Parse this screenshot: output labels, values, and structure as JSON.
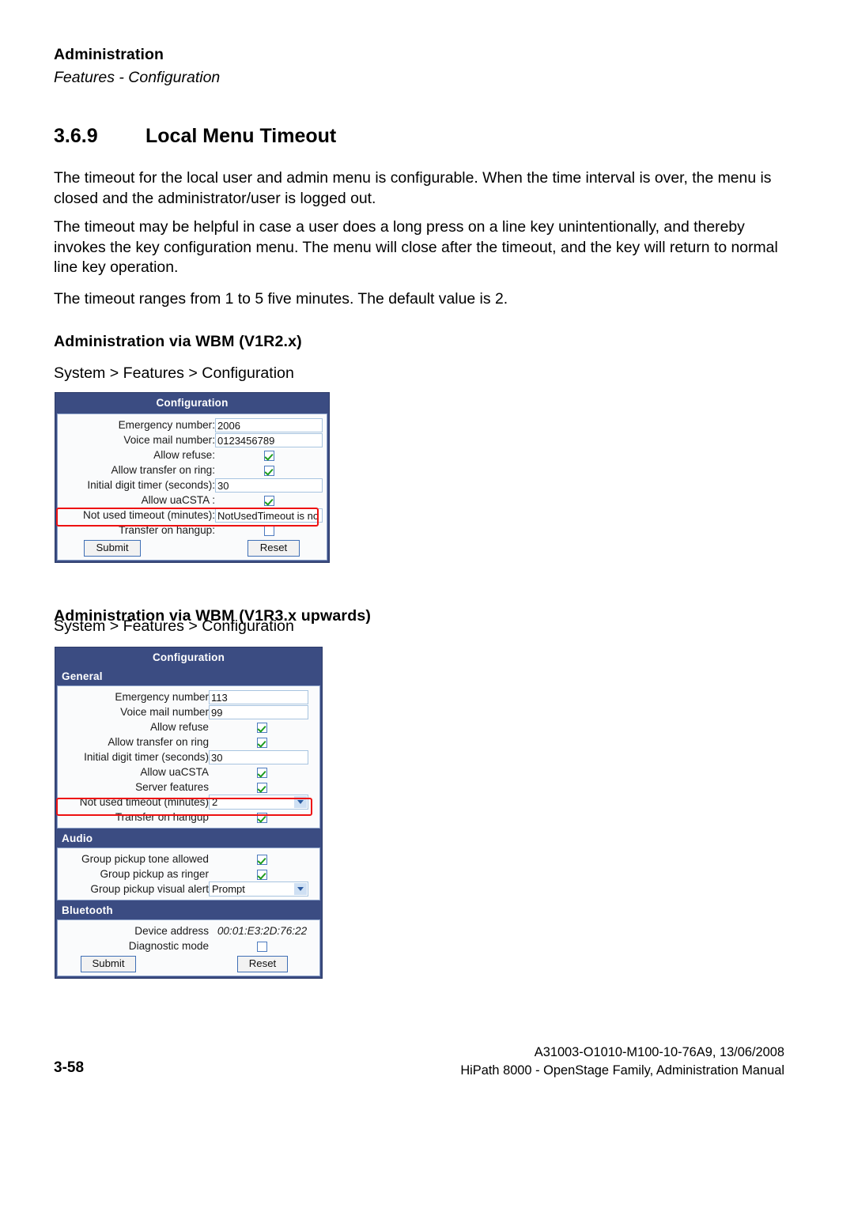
{
  "runhead": {
    "title": "Administration",
    "subtitle": "Features - Configuration"
  },
  "section": {
    "number": "3.6.9",
    "title": "Local Menu Timeout"
  },
  "paragraphs": {
    "p1": "The timeout for the local user and admin menu is configurable. When the time interval is over, the menu is closed and the administrator/user is logged out.",
    "p2": "The timeout may be helpful in case a user does a long press on a line key unintentionally, and thereby invokes the key configuration menu. The menu will close after the timeout, and the key will return to normal line key operation.",
    "p3": "The timeout ranges from 1 to 5 five minutes. The default value is 2."
  },
  "v1r2": {
    "heading": "Administration via WBM (V1R2.x)",
    "breadcrumb": "System > Features > Configuration",
    "panel": {
      "title": "Configuration",
      "rows": [
        {
          "label": "Emergency number:",
          "type": "text",
          "value": "2006"
        },
        {
          "label": "Voice mail number:",
          "type": "text",
          "value": "0123456789"
        },
        {
          "label": "Allow refuse:",
          "type": "checkbox",
          "checked": true
        },
        {
          "label": "Allow transfer on ring:",
          "type": "checkbox",
          "checked": true
        },
        {
          "label": "Initial digit timer (seconds):",
          "type": "text",
          "value": "30"
        },
        {
          "label": "Allow uaCSTA :",
          "type": "checkbox",
          "checked": true
        },
        {
          "label": "Not used timeout (minutes):",
          "type": "text",
          "value": "NotUsedTimeout is no",
          "highlighted": true
        },
        {
          "label": "Transfer on hangup:",
          "type": "checkbox",
          "checked": false
        }
      ],
      "submit_label": "Submit",
      "reset_label": "Reset"
    }
  },
  "v1r3": {
    "heading": "Administration via WBM (V1R3.x upwards)",
    "breadcrumb": "System > Features > Configuration",
    "panel": {
      "title": "Configuration",
      "sections": [
        {
          "name": "General",
          "rows": [
            {
              "label": "Emergency number",
              "type": "text",
              "value": "113"
            },
            {
              "label": "Voice mail number",
              "type": "text",
              "value": "99"
            },
            {
              "label": "Allow refuse",
              "type": "checkbox",
              "checked": true
            },
            {
              "label": "Allow transfer on ring",
              "type": "checkbox",
              "checked": true
            },
            {
              "label": "Initial digit timer (seconds)",
              "type": "text",
              "value": "30"
            },
            {
              "label": "Allow uaCSTA",
              "type": "checkbox",
              "checked": true
            },
            {
              "label": "Server features",
              "type": "checkbox",
              "checked": true
            },
            {
              "label": "Not used timeout (minutes)",
              "type": "select",
              "value": "2",
              "highlighted": true
            },
            {
              "label": "Transfer on hangup",
              "type": "checkbox",
              "checked": true
            }
          ]
        },
        {
          "name": "Audio",
          "rows": [
            {
              "label": "Group pickup tone allowed",
              "type": "checkbox",
              "checked": true
            },
            {
              "label": "Group pickup as ringer",
              "type": "checkbox",
              "checked": true
            },
            {
              "label": "Group pickup visual alert",
              "type": "select",
              "value": "Prompt"
            }
          ]
        },
        {
          "name": "Bluetooth",
          "rows": [
            {
              "label": "Device address",
              "type": "static",
              "value": "00:01:E3:2D:76:22"
            },
            {
              "label": "Diagnostic mode",
              "type": "checkbox",
              "checked": false
            }
          ]
        }
      ],
      "submit_label": "Submit",
      "reset_label": "Reset"
    }
  },
  "footer": {
    "page_number": "3-58",
    "doc_id": "A31003-O1010-M100-10-76A9, 13/06/2008",
    "doc_title": "HiPath 8000 - OpenStage Family, Administration Manual"
  },
  "colors": {
    "panel_blue": "#3b4c82",
    "highlight_red": "#ee1111",
    "check_green": "#1f9d1f"
  }
}
